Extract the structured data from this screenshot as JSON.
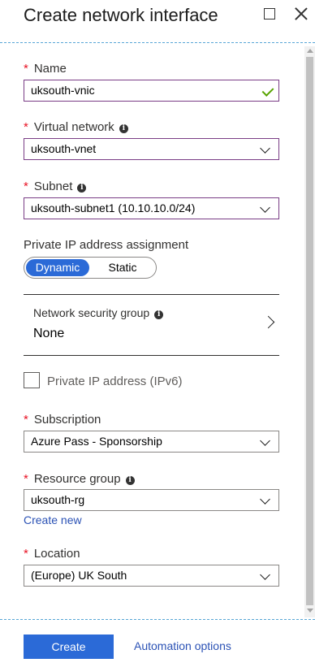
{
  "header": {
    "title": "Create network interface"
  },
  "form": {
    "name": {
      "label": "Name",
      "value": "uksouth-vnic"
    },
    "virtual_network": {
      "label": "Virtual network",
      "value": "uksouth-vnet"
    },
    "subnet": {
      "label": "Subnet",
      "value": "uksouth-subnet1 (10.10.10.0/24)"
    },
    "private_ip_assignment": {
      "label": "Private IP address assignment",
      "options": [
        "Dynamic",
        "Static"
      ],
      "selected": "Dynamic"
    },
    "nsg": {
      "label": "Network security group",
      "value": "None"
    },
    "ipv6": {
      "label": "Private IP address (IPv6)",
      "checked": false
    },
    "subscription": {
      "label": "Subscription",
      "value": "Azure Pass - Sponsorship"
    },
    "resource_group": {
      "label": "Resource group",
      "value": "uksouth-rg",
      "create_new": "Create new"
    },
    "location": {
      "label": "Location",
      "value": "(Europe) UK South"
    }
  },
  "footer": {
    "create_label": "Create",
    "automation_label": "Automation options"
  },
  "colors": {
    "accent": "#2b6ad7",
    "link": "#2b52b5",
    "required": "#e81123",
    "focus_border": "#7a3d86",
    "valid": "#57a300"
  }
}
